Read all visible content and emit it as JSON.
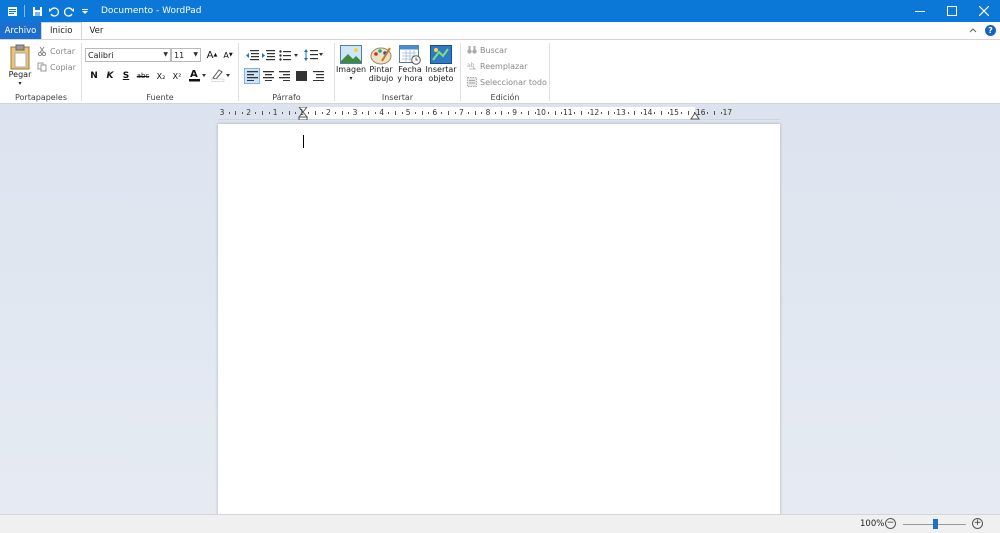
{
  "window": {
    "title": "Documento - WordPad",
    "controls": [
      "minimize-icon",
      "maximize-icon",
      "close-icon"
    ]
  },
  "quick_access": [
    "save-icon",
    "undo-icon",
    "redo-icon",
    "customize-icon"
  ],
  "tabs": [
    {
      "label": "Archivo"
    },
    {
      "label": "Inicio"
    },
    {
      "label": "Ver"
    }
  ],
  "ribbon": {
    "clipboard": {
      "label": "Portapapeles",
      "paste": "Pegar",
      "cut": "Cortar",
      "copy": "Copiar"
    },
    "font": {
      "label": "Fuente",
      "family": "Calibri",
      "size": "11",
      "bold": "N",
      "italic": "K",
      "underline": "S",
      "strike": "abc",
      "subscript": "X₂",
      "superscript": "X²",
      "grow": "A",
      "shrink": "A"
    },
    "paragraph": {
      "label": "Párrafo"
    },
    "insert": {
      "label": "Insertar",
      "image": "Imagen",
      "paint_line1": "Pintar",
      "paint_line2": "dibujo",
      "datetime_line1": "Fecha",
      "datetime_line2": "y hora",
      "object_line1": "Insertar",
      "object_line2": "objeto"
    },
    "editing": {
      "label": "Edición",
      "find": "Buscar",
      "replace": "Reemplazar",
      "select_all": "Seleccionar todo"
    }
  },
  "ruler": {
    "labels": [
      "3",
      "2",
      "1",
      "1",
      "2",
      "3",
      "4",
      "5",
      "6",
      "7",
      "8",
      "9",
      "10",
      "11",
      "12",
      "13",
      "14",
      "15",
      "16",
      "17"
    ]
  },
  "status": {
    "zoom": "100%",
    "zoom_level_percent": 100
  },
  "colors": {
    "titlebar": "#0b78d7",
    "file_tab": "#1c6fd0",
    "accent": "#1e6fc8"
  }
}
